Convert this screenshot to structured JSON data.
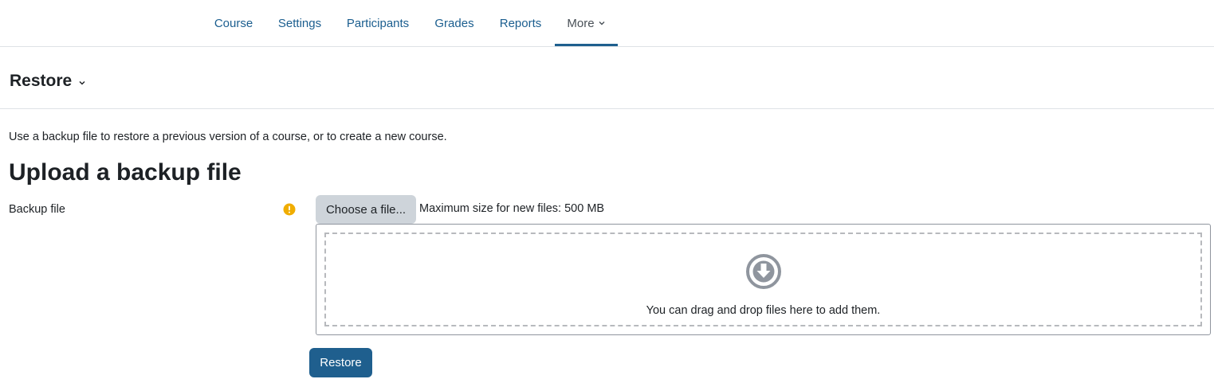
{
  "nav": {
    "items": [
      {
        "label": "Course"
      },
      {
        "label": "Settings"
      },
      {
        "label": "Participants"
      },
      {
        "label": "Grades"
      },
      {
        "label": "Reports"
      },
      {
        "label": "More"
      }
    ],
    "active": "More"
  },
  "tertiary": {
    "selector_label": "Restore"
  },
  "main": {
    "intro_text": "Use a backup file to restore a previous version of a course, or to create a new course.",
    "heading": "Upload a backup file",
    "form": {
      "field_label": "Backup file",
      "choose_button_label": "Choose a file...",
      "max_size_text": "Maximum size for new files: 500 MB",
      "dropzone_text": "You can drag and drop files here to add them.",
      "submit_label": "Restore"
    }
  },
  "icons": {
    "required": "exclamation-circle-icon",
    "dropzone": "arrow-circle-down-icon",
    "chevron": "chevron-down-icon"
  },
  "colors": {
    "link": "#1b5e8f",
    "primary_button": "#1f5f8e",
    "secondary_button": "#ced4da",
    "required_icon": "#f0ad00",
    "border": "#dee2e6"
  }
}
